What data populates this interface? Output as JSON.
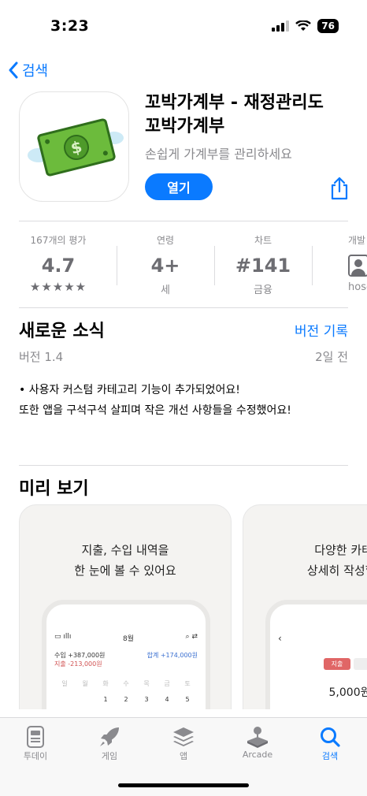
{
  "status": {
    "time": "3:23",
    "battery": "76"
  },
  "nav": {
    "back_label": "검색"
  },
  "app": {
    "title_line1": "꼬박가계부 - 재정관리도",
    "title_line2": "꼬박가계부",
    "subtitle": "손쉽게 가계부를 관리하세요",
    "open_label": "열기"
  },
  "stats": [
    {
      "label": "167개의 평가",
      "value": "4.7",
      "sub": "★★★★★"
    },
    {
      "label": "연령",
      "value": "4+",
      "sub": "세"
    },
    {
      "label": "차트",
      "value": "#141",
      "sub": "금융"
    },
    {
      "label": "개발",
      "value": "",
      "sub": "hoseon"
    }
  ],
  "whats_new": {
    "title": "새로운 소식",
    "history_link": "버전 기록",
    "version": "버전 1.4",
    "date": "2일 전",
    "line1": "• 사용자 커스텀 카테고리 기능이 추가되었어요!",
    "line2": "또한 앱을 구석구석 살피며 작은 개선 사항들을 수정했어요!"
  },
  "preview": {
    "title": "미리 보기",
    "shot1_line1": "지출, 수입 내역을",
    "shot1_line2": "한 눈에 볼 수 있어요",
    "shot1_month": "8월",
    "shot1_income": "수입 +387,000원",
    "shot1_expense": "지출 -213,000원",
    "shot1_total": "합계 +174,000원",
    "shot2_line1": "다양한 카테고",
    "shot2_line2": "상세히 작성할 수",
    "shot2_tab": "지출",
    "shot2_amount": "5,000원"
  },
  "tabs": [
    {
      "label": "투데이"
    },
    {
      "label": "게임"
    },
    {
      "label": "앱"
    },
    {
      "label": "Arcade"
    },
    {
      "label": "검색"
    }
  ],
  "colors": {
    "accent": "#0a7aff",
    "muted": "#8a8a8e"
  }
}
